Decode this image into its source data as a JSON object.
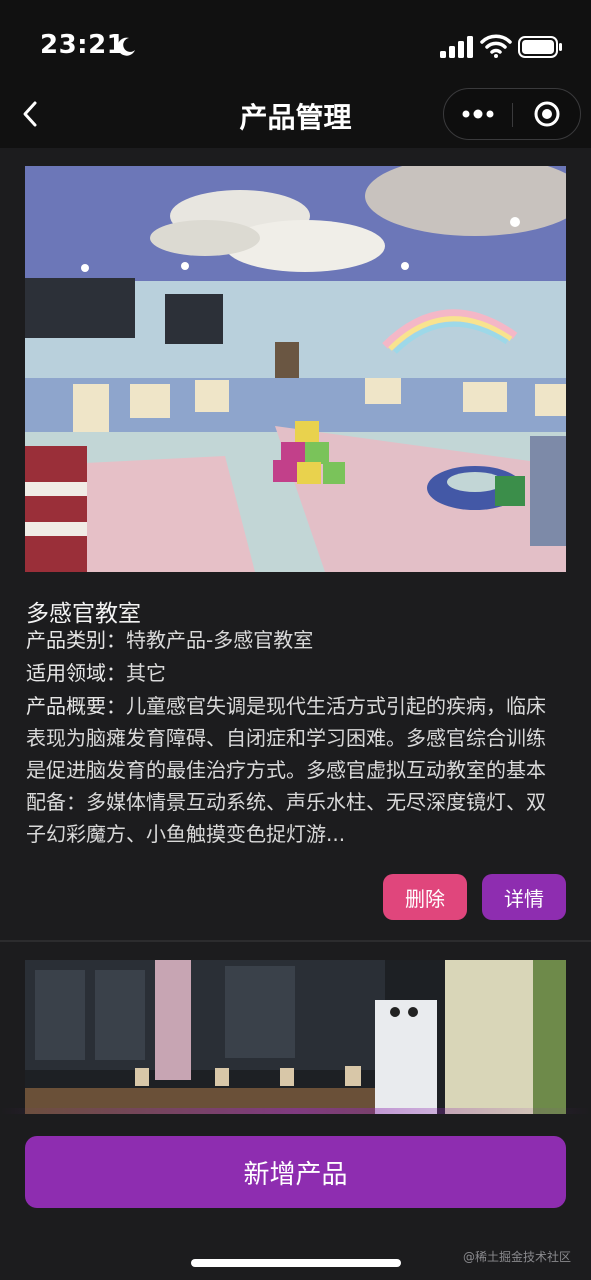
{
  "status_bar": {
    "time": "23:21",
    "icons": [
      "moon-icon",
      "signal-icon",
      "wifi-icon",
      "battery-icon"
    ]
  },
  "nav": {
    "title": "产品管理",
    "back_icon": "chevron-left-icon",
    "more_icon": "more-dots-icon",
    "close_icon": "target-close-icon"
  },
  "products": [
    {
      "name": "多感官教室",
      "category_label": "产品类别：",
      "category_value": "特教产品-多感官教室",
      "field_label": "适用领域：",
      "field_value": "其它",
      "summary_label": "产品概要：",
      "summary_value": "儿童感官失调是现代生活方式引起的疾病，临床表现为脑瘫发育障碍、自闭症和学习困难。多感官综合训练是促进脑发育的最佳治疗方式。多感官虚拟互动教室的基本配备：多媒体情景互动系统、声乐水柱、无尽深度镜灯、双子幻彩魔方、小鱼触摸变色捉灯游...",
      "delete_label": "删除",
      "detail_label": "详情"
    }
  ],
  "footer": {
    "add_label": "新增产品",
    "watermark": "@稀土掘金技术社区"
  },
  "colors": {
    "background": "#1c1c1e",
    "bar": "#111111",
    "delete": "#e0467c",
    "accent": "#8e2db0"
  }
}
